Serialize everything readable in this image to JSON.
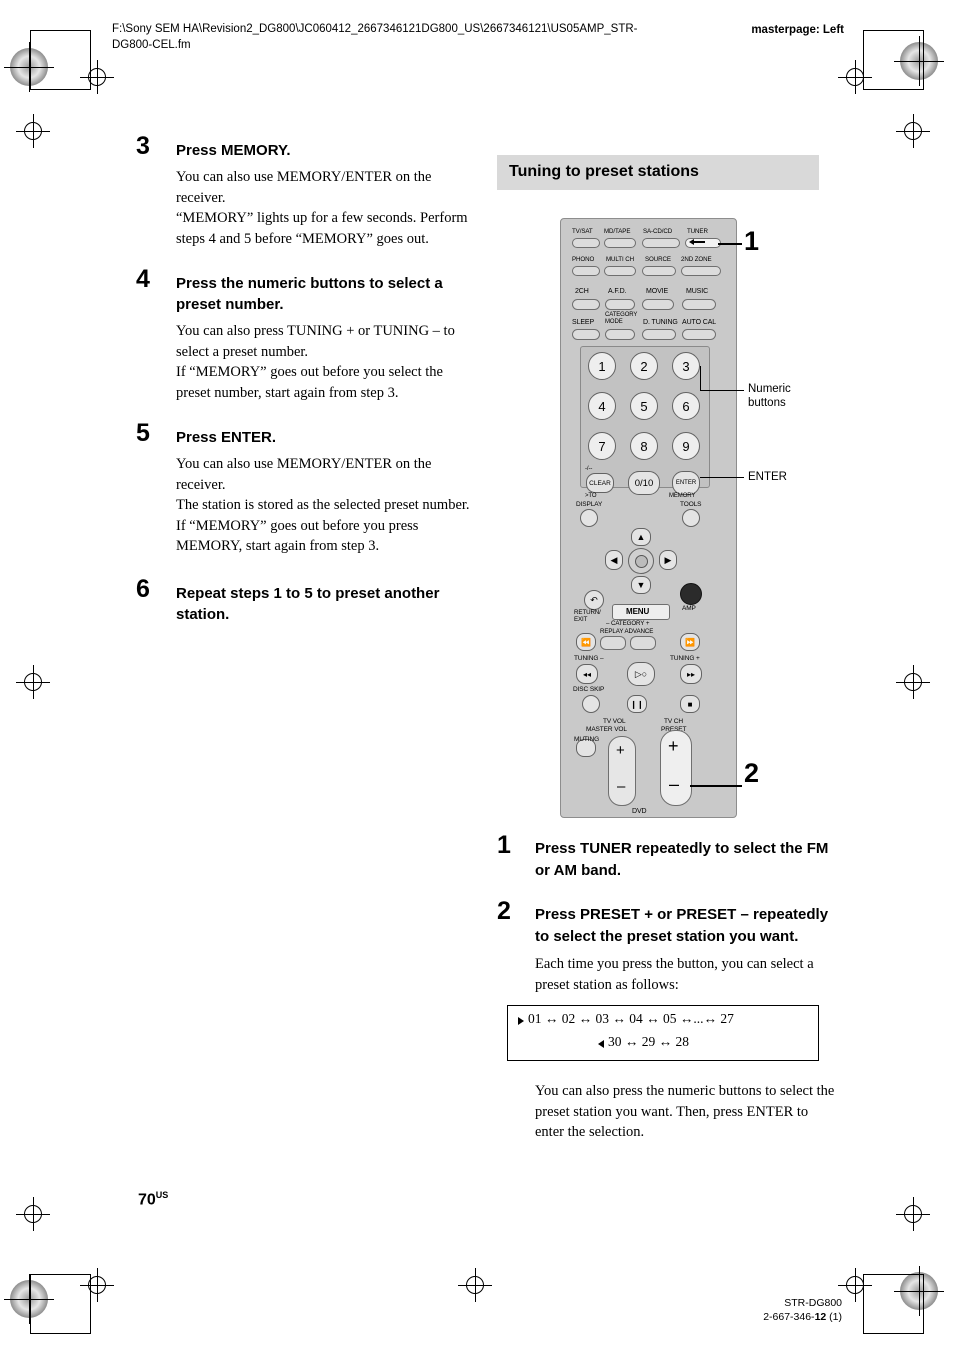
{
  "header": {
    "path": "F:\\Sony SEM HA\\Revision2_DG800\\JC060412_2667346121DG800_US\\2667346121\\US05AMP_STR-DG800-CEL.fm",
    "masterpage": "masterpage: Left"
  },
  "left_steps": [
    {
      "num": "3",
      "title": "Press MEMORY.",
      "body": "You can also use MEMORY/ENTER on the receiver.\n“MEMORY” lights up for a few seconds. Perform steps 4 and 5 before “MEMORY” goes out."
    },
    {
      "num": "4",
      "title": "Press the numeric buttons to select a preset number.",
      "body": "You can also press TUNING + or TUNING – to select a preset number.\nIf “MEMORY” goes out before you select the preset number, start again from step 3."
    },
    {
      "num": "5",
      "title": "Press ENTER.",
      "body": "You can also use MEMORY/ENTER on the receiver.\nThe station is stored as the selected preset number.\nIf “MEMORY” goes out before you press MEMORY, start again from step 3."
    },
    {
      "num": "6",
      "title": "Repeat steps 1 to 5 to preset another station.",
      "body": ""
    }
  ],
  "section": {
    "title": "Tuning to preset stations"
  },
  "callouts": {
    "one": "1",
    "two": "2",
    "numeric_buttons": "Numeric\nbuttons",
    "enter": "ENTER"
  },
  "remote": {
    "row1": [
      "TV/SAT",
      "MD/TAPE",
      "SA-CD/CD",
      "TUNER"
    ],
    "row2": [
      "PHONO",
      "MULTI CH",
      "SOURCE",
      "2ND ZONE"
    ],
    "row3": [
      "2CH",
      "A.F.D.",
      "MOVIE",
      "MUSIC"
    ],
    "row4": [
      "SLEEP",
      "CATEGORY\nMODE",
      "D. TUNING",
      "AUTO CAL"
    ],
    "numpad": [
      "1",
      "2",
      "3",
      "4",
      "5",
      "6",
      "7",
      "8",
      "9"
    ],
    "clear": "CLEAR",
    "clear_sub": ">TO",
    "clear_top": "-/--",
    "zero": "0/10",
    "enter": "ENTER",
    "enter_sub": "MEMORY",
    "display": "DISPLAY",
    "tools": "TOOLS",
    "return": "RETURN/\nEXIT",
    "menu": "MENU",
    "amp": "AMP",
    "category": "– CATEGORY +",
    "replay_advance": "REPLAY ADVANCE",
    "tuning_minus": "TUNING –",
    "tuning_plus": "TUNING +",
    "disc_skip": "DISC SKIP",
    "tv_vol": "TV VOL",
    "master_vol": "MASTER VOL",
    "tv_ch": "TV CH",
    "preset": "PRESET",
    "muting": "MUTING",
    "dvd": "DVD",
    "plus": "+",
    "minus": "–"
  },
  "right_steps": [
    {
      "num": "1",
      "title": "Press TUNER repeatedly to select the FM or AM band.",
      "body": ""
    },
    {
      "num": "2",
      "title": "Press PRESET + or PRESET – repeatedly to select the preset station you want.",
      "body": "Each time you press the button, you can select a preset station as follows:"
    }
  ],
  "preset_diagram": {
    "top_row": "01 ↔ 02 ↔ 03 ↔ 04 ↔ 05 ↔...↔ 27",
    "bottom_row": "30 ↔ 29 ↔ 28"
  },
  "closing_text": "You can also press the numeric buttons to select the preset station you want. Then, press ENTER to enter the selection.",
  "footer": {
    "page": "70",
    "page_sup": "US",
    "model": "STR-DG800",
    "doc_a": "2-667-346-",
    "doc_b": "12",
    "doc_c": " (1)"
  }
}
